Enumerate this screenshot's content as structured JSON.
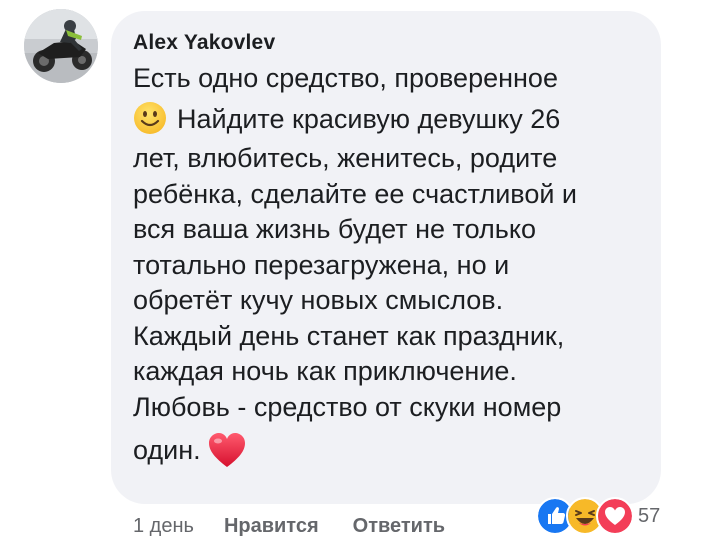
{
  "comment": {
    "author": "Alex Yakovlev",
    "lines": [
      "Есть одно средство, проверенное",
      "Найдите красивую девушку 26",
      "лет, влюбитесь, женитесь, родите",
      "ребёнка, сделайте ее счастливой и",
      "вся ваша жизнь будет не только",
      "тотально перезагружена, но и",
      "обретёт кучу новых смыслов.",
      "Каждый день станет как праздник,",
      "каждая ночь как приключение.",
      "Любовь - средство от скуки номер",
      "один."
    ],
    "emoji_inline": [
      "smile-emoji",
      "heart-emoji"
    ]
  },
  "actions": {
    "time": "1 день",
    "like": "Нравится",
    "reply": "Ответить"
  },
  "reactions": {
    "icons": [
      "like-reaction-icon",
      "haha-reaction-icon",
      "love-reaction-icon"
    ],
    "count": "57"
  },
  "colors": {
    "bubble": "#f1f2f6",
    "text": "#1c1e21",
    "meta": "#65676b",
    "like_blue": "#1877f2",
    "love_red": "#f33e58",
    "haha_yellow": "#f7b928"
  }
}
